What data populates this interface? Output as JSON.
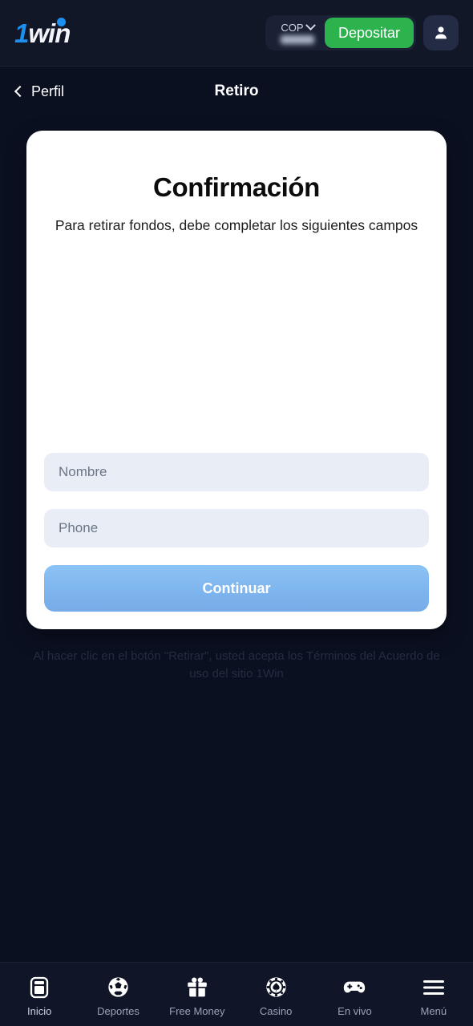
{
  "header": {
    "logo": {
      "part1": "1",
      "part2": "win",
      "name": "1win"
    },
    "currency": "COP",
    "balance": "0.00",
    "deposit_label": "Depositar",
    "profile_icon": "user-icon",
    "chevron_icon": "chevron-down-icon",
    "colors": {
      "deposit_green": "#2db34e",
      "accent_blue": "#1b90ef",
      "panel": "#121728"
    }
  },
  "subnav": {
    "back_label": "Perfil",
    "back_icon": "chevron-left-icon",
    "title": "Retiro"
  },
  "card": {
    "title": "Confirmación",
    "subtitle": "Para retirar fondos, debe completar los siguientes campos",
    "fields": [
      {
        "name": "nombre",
        "placeholder": "Nombre",
        "value": ""
      },
      {
        "name": "phone",
        "placeholder": "Phone",
        "value": ""
      }
    ],
    "submit_label": "Continuar"
  },
  "disclaimer": "Al hacer clic en el botón \"Retirar\", usted acepta los Términos del Acuerdo de uso del sitio 1Win",
  "bottomnav": {
    "items": [
      {
        "label": "Inicio",
        "icon": "home-phone-icon"
      },
      {
        "label": "Deportes",
        "icon": "soccer-ball-icon"
      },
      {
        "label": "Free Money",
        "icon": "gift-icon"
      },
      {
        "label": "Casino",
        "icon": "casino-chip-icon"
      },
      {
        "label": "En vivo",
        "icon": "gamepad-icon"
      },
      {
        "label": "Menú",
        "icon": "hamburger-menu-icon"
      }
    ]
  }
}
